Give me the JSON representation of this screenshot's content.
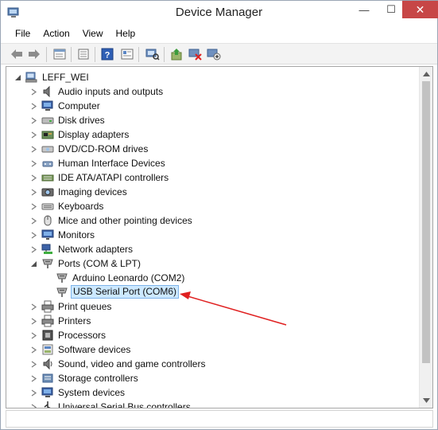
{
  "window": {
    "title": "Device Manager"
  },
  "title_buttons": {
    "minimize": "—",
    "maximize": "☐",
    "close": "✕"
  },
  "menu": [
    "File",
    "Action",
    "View",
    "Help"
  ],
  "toolbar_icons": [
    "back-icon",
    "forward-icon",
    "properties-view-icon",
    "show-hide-icon",
    "help-icon",
    "details-icon",
    "scan-hardware-icon",
    "update-driver-icon",
    "uninstall-icon",
    "enable-device-icon"
  ],
  "tree": {
    "root": "LEFF_WEI",
    "categories": [
      {
        "label": "Audio inputs and outputs",
        "icon": "speaker-icon",
        "expanded": false
      },
      {
        "label": "Computer",
        "icon": "computer-icon",
        "expanded": false
      },
      {
        "label": "Disk drives",
        "icon": "disk-drive-icon",
        "expanded": false
      },
      {
        "label": "Display adapters",
        "icon": "display-adapter-icon",
        "expanded": false
      },
      {
        "label": "DVD/CD-ROM drives",
        "icon": "dvd-drive-icon",
        "expanded": false
      },
      {
        "label": "Human Interface Devices",
        "icon": "hid-icon",
        "expanded": false
      },
      {
        "label": "IDE ATA/ATAPI controllers",
        "icon": "ide-controller-icon",
        "expanded": false
      },
      {
        "label": "Imaging devices",
        "icon": "camera-icon",
        "expanded": false
      },
      {
        "label": "Keyboards",
        "icon": "keyboard-icon",
        "expanded": false
      },
      {
        "label": "Mice and other pointing devices",
        "icon": "mouse-icon",
        "expanded": false
      },
      {
        "label": "Monitors",
        "icon": "monitor-icon",
        "expanded": false
      },
      {
        "label": "Network adapters",
        "icon": "network-icon",
        "expanded": false
      },
      {
        "label": "Ports (COM & LPT)",
        "icon": "port-icon",
        "expanded": true,
        "children": [
          {
            "label": "Arduino Leonardo (COM2)",
            "icon": "port-icon",
            "selected": false
          },
          {
            "label": "USB Serial Port (COM6)",
            "icon": "port-icon",
            "selected": true
          }
        ]
      },
      {
        "label": "Print queues",
        "icon": "printer-icon",
        "expanded": false
      },
      {
        "label": "Printers",
        "icon": "printer-icon",
        "expanded": false
      },
      {
        "label": "Processors",
        "icon": "processor-icon",
        "expanded": false
      },
      {
        "label": "Software devices",
        "icon": "software-device-icon",
        "expanded": false
      },
      {
        "label": "Sound, video and game controllers",
        "icon": "sound-icon",
        "expanded": false
      },
      {
        "label": "Storage controllers",
        "icon": "storage-icon",
        "expanded": false
      },
      {
        "label": "System devices",
        "icon": "system-device-icon",
        "expanded": false
      },
      {
        "label": "Universal Serial Bus controllers",
        "icon": "usb-icon",
        "expanded": false
      }
    ]
  },
  "colors": {
    "selection_bg": "#cce8ff",
    "selection_border": "#7eb4ea",
    "close_button": "#c74646",
    "annotation_arrow": "#e02020"
  }
}
